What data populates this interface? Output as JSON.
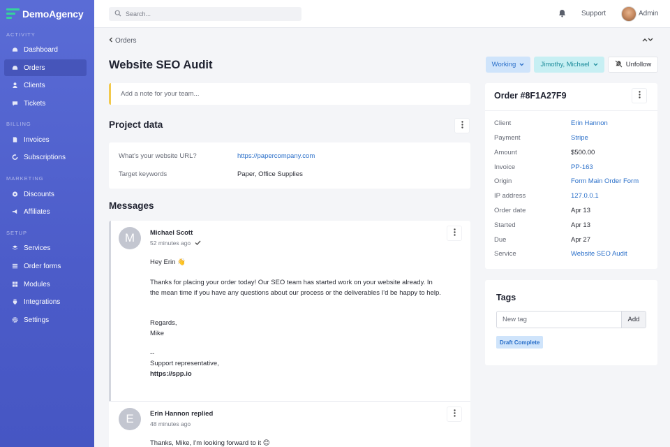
{
  "brand": {
    "name": "DemoAgency"
  },
  "sidebar": {
    "sections": [
      {
        "label": "ACTIVITY"
      },
      {
        "label": "BILLING"
      },
      {
        "label": "MARKETING"
      },
      {
        "label": "SETUP"
      }
    ],
    "items": [
      {
        "label": "Dashboard",
        "icon": "dashboard-icon"
      },
      {
        "label": "Orders",
        "icon": "inbox-icon",
        "active": true
      },
      {
        "label": "Clients",
        "icon": "user-icon"
      },
      {
        "label": "Tickets",
        "icon": "chat-icon"
      },
      {
        "label": "Invoices",
        "icon": "document-icon"
      },
      {
        "label": "Subscriptions",
        "icon": "refresh-icon"
      },
      {
        "label": "Discounts",
        "icon": "discount-icon"
      },
      {
        "label": "Affiliates",
        "icon": "megaphone-icon"
      },
      {
        "label": "Services",
        "icon": "stack-icon"
      },
      {
        "label": "Order forms",
        "icon": "list-icon"
      },
      {
        "label": "Modules",
        "icon": "grid-icon"
      },
      {
        "label": "Integrations",
        "icon": "plug-icon"
      },
      {
        "label": "Settings",
        "icon": "gear-icon"
      }
    ]
  },
  "topbar": {
    "search_placeholder": "Search...",
    "support_label": "Support",
    "user_label": "Admin"
  },
  "breadcrumb": {
    "label": "Orders"
  },
  "page": {
    "title": "Website SEO Audit"
  },
  "actions": {
    "status_label": "Working",
    "assignee_label": "Jimothy, Michael",
    "unfollow_label": "Unfollow"
  },
  "note": {
    "placeholder": "Add a note for your team..."
  },
  "project_data": {
    "title": "Project data",
    "rows": [
      {
        "label": "What's your website URL?",
        "value": "https://papercompany.com"
      },
      {
        "label": "Target keywords",
        "value": "Paper, Office Supplies"
      }
    ]
  },
  "messages": {
    "title": "Messages",
    "items": [
      {
        "initial": "M",
        "author": "Michael Scott",
        "time": "52 minutes ago",
        "greeting": "Hey Erin 👋",
        "body": "Thanks for placing your order today! Our SEO team has started work on your website already. In the mean time if you have any questions about our process or the deliverables I'd be happy to help.",
        "regards": "Regards,",
        "signoff": "Mike",
        "sig_dash": "--",
        "sig_role": "Support representative,",
        "sig_link": "https://spp.io"
      },
      {
        "initial": "E",
        "author": "Erin Hannon replied",
        "time": "48 minutes ago",
        "body": "Thanks, Mike, I'm looking forward to it 😊"
      }
    ]
  },
  "order": {
    "title": "Order #8F1A27F9",
    "rows": [
      {
        "label": "Client",
        "value": "Erin Hannon",
        "link": true
      },
      {
        "label": "Payment",
        "value": "Stripe",
        "link": true
      },
      {
        "label": "Amount",
        "value": "$500.00",
        "link": false
      },
      {
        "label": "Invoice",
        "value": "PP-163",
        "link": true
      },
      {
        "label": "Origin",
        "value": "Form Main Order Form",
        "link": true
      },
      {
        "label": "IP address",
        "value": "127.0.0.1",
        "link": true
      },
      {
        "label": "Order date",
        "value": "Apr 13",
        "link": false
      },
      {
        "label": "Started",
        "value": "Apr 13",
        "link": false
      },
      {
        "label": "Due",
        "value": "Apr 27",
        "link": false
      },
      {
        "label": "Service",
        "value": "Website SEO Audit",
        "link": true
      }
    ]
  },
  "tags": {
    "title": "Tags",
    "input_placeholder": "New tag",
    "add_label": "Add",
    "items": [
      "Draft Complete"
    ]
  },
  "colors": {
    "sidebar": "#5a6cd6",
    "brand_accent": "#36d39c",
    "link": "#2a6fc9",
    "status_bg": "#cfe4fb",
    "assignee_bg": "#c7eff3",
    "note_accent": "#f2c94c"
  }
}
